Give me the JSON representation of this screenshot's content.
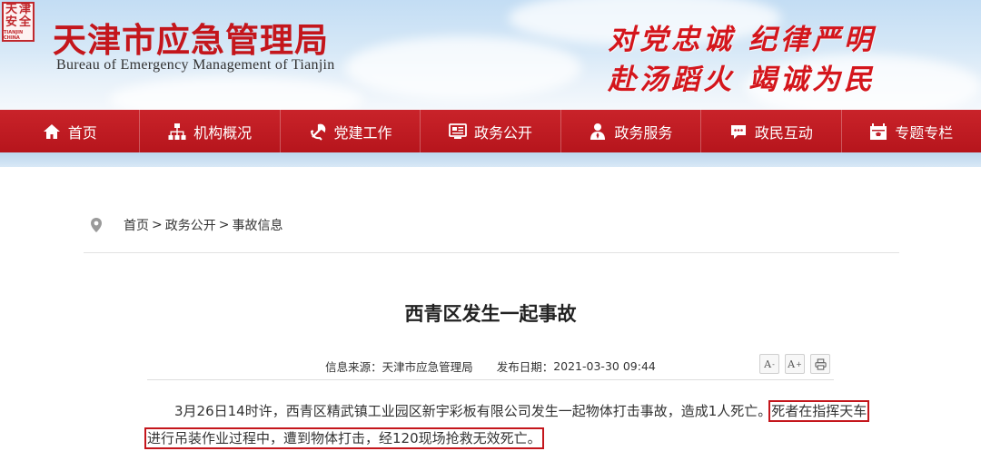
{
  "header": {
    "seal_chars": [
      "天",
      "津",
      "安",
      "全"
    ],
    "seal_caption": "TIANJIN CHINA",
    "title_cn": "天津市应急管理局",
    "title_en": "Bureau  of  Emergency  Management  of  Tianjin",
    "slogan_line1": "对党忠诚  纪律严明",
    "slogan_line2": "赴汤蹈火  竭诚为民"
  },
  "nav": {
    "items": [
      {
        "label": "首页",
        "icon": "home-icon"
      },
      {
        "label": "机构概况",
        "icon": "org-chart-icon"
      },
      {
        "label": "党建工作",
        "icon": "party-emblem-icon"
      },
      {
        "label": "政务公开",
        "icon": "gov-open-icon"
      },
      {
        "label": "政务服务",
        "icon": "service-person-icon"
      },
      {
        "label": "政民互动",
        "icon": "chat-bubble-icon"
      },
      {
        "label": "专题专栏",
        "icon": "feature-column-icon"
      }
    ]
  },
  "breadcrumb": {
    "icon": "location-pin-icon",
    "items": [
      "首页",
      "政务公开",
      "事故信息"
    ],
    "separator": ">"
  },
  "article": {
    "title": "西青区发生一起事故",
    "source_label": "信息来源：",
    "source": "天津市应急管理局",
    "date_label": "发布日期：",
    "date": "2021-03-30 09:44",
    "tools": [
      "A-",
      "A+",
      "print"
    ],
    "para_line1_plain": "3月26日14时许，西青区精武镇工业园区新宇彩板有限公司发生一起物体打击事故，造成1人死亡。",
    "para_line1_highlight": "死者在指挥天车",
    "para_line2_highlight": "进行吊装作业过程中，遭到物体打击，经120现场抢救无效死亡。"
  },
  "colors": {
    "brand_red": "#c4161c",
    "nav_red": "#c0202a",
    "sky_blue": "#c3ddf4"
  }
}
